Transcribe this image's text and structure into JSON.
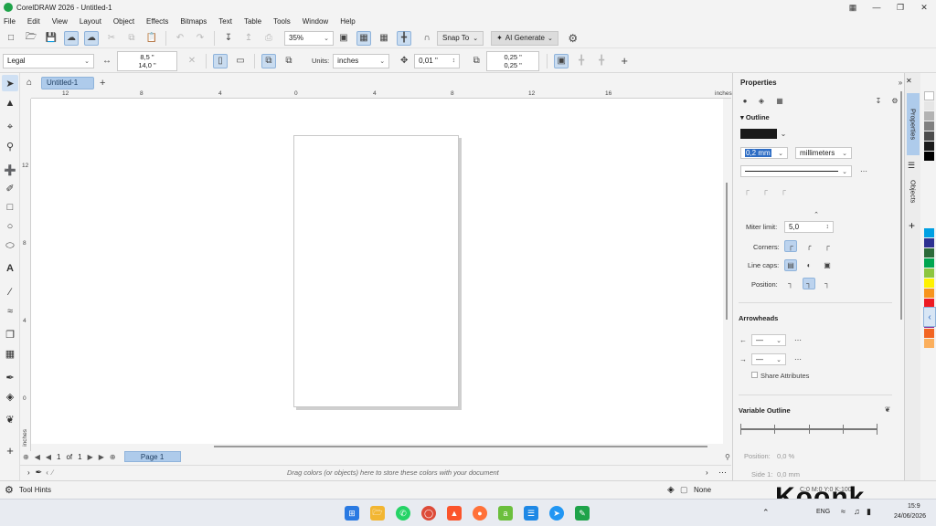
{
  "window": {
    "title": "CorelDRAW 2026 - Untitled-1"
  },
  "menu": [
    "File",
    "Edit",
    "View",
    "Layout",
    "Object",
    "Effects",
    "Bitmaps",
    "Text",
    "Table",
    "Tools",
    "Window",
    "Help"
  ],
  "toolbar1": {
    "zoom": "35%",
    "snap_to": "Snap To",
    "ai_generate": "AI Generate"
  },
  "toolbar2": {
    "page_size": "Legal",
    "width": "8,5 \"",
    "height": "14,0 \"",
    "units_label": "Units:",
    "units": "inches",
    "nudge": "0,01 \"",
    "dup_x": "0,25 \"",
    "dup_y": "0,25 \""
  },
  "tabs": {
    "document": "Untitled-1"
  },
  "ruler": {
    "h_labels": [
      "12",
      "8",
      "4",
      "0",
      "4",
      "8",
      "12",
      "16"
    ],
    "units": "inches",
    "v_labels": [
      "12",
      "8",
      "4",
      "0"
    ],
    "v_units": "inches"
  },
  "page_nav": {
    "current": "1",
    "of": "of",
    "total": "1",
    "page_tab": "Page 1"
  },
  "doc_palette": {
    "hint": "Drag colors (or objects) here to store these colors with your document"
  },
  "status": {
    "tool_hints": "Tool Hints",
    "fill": "None",
    "outline_info": "C:0 M:0 Y:0 K:100"
  },
  "properties": {
    "title": "Properties",
    "outline_section": "Outline",
    "outline_width": "0,2 mm",
    "outline_units": "millimeters",
    "miter_label": "Miter limit:",
    "miter_value": "5,0",
    "corners_label": "Corners:",
    "linecaps_label": "Line caps:",
    "position_label": "Position:",
    "arrowheads_section": "Arrowheads",
    "share_attributes": "Share Attributes",
    "variable_outline_section": "Variable Outline",
    "vo_position_label": "Position:",
    "vo_position_value": "0,0 %",
    "vo_side_label": "Side 1:",
    "vo_side_value": "0,0 mm"
  },
  "docker_tabs": [
    "Properties",
    "Objects"
  ],
  "colors": {
    "accent": "#aecbeb",
    "palette": [
      "#ffffff",
      "#e6e6e6",
      "#b3b3b3",
      "#808080",
      "#4d4d4d",
      "#1a1a1a",
      "#000000",
      "#00a0e3",
      "#2d3192",
      "#2c6b3a",
      "#00a651",
      "#8dc63f",
      "#fff200",
      "#f7941d",
      "#ed1c24",
      "#ec008c",
      "#92278f",
      "#f26522",
      "#fbaf5d"
    ]
  },
  "taskbar": {
    "time": "15:9",
    "date": "24/06/2026",
    "lang": "ENG"
  },
  "watermark": "Koonk"
}
